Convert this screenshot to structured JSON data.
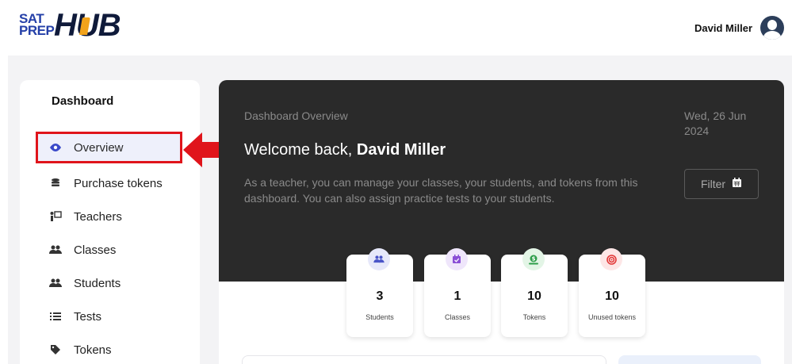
{
  "header": {
    "logo_top": "SAT",
    "logo_bottom": "PREP",
    "logo_hub": "HUB",
    "user_name": "David Miller"
  },
  "sidebar": {
    "title": "Dashboard",
    "items": [
      {
        "label": "Overview",
        "icon": "eye-icon",
        "active": true
      },
      {
        "label": "Purchase tokens",
        "icon": "coins-icon"
      },
      {
        "label": "Teachers",
        "icon": "teacher-icon"
      },
      {
        "label": "Classes",
        "icon": "users-icon"
      },
      {
        "label": "Students",
        "icon": "users-icon"
      },
      {
        "label": "Tests",
        "icon": "list-icon"
      },
      {
        "label": "Tokens",
        "icon": "tag-icon"
      }
    ]
  },
  "hero": {
    "subtitle": "Dashboard Overview",
    "date": "Wed, 26 Jun 2024",
    "welcome_prefix": "Welcome back, ",
    "welcome_name": "David Miller",
    "description": "As a teacher, you can manage your classes, your students, and tokens from this dashboard. You can also assign practice tests to your students.",
    "filter_label": "Filter"
  },
  "stats": [
    {
      "value": "3",
      "label": "Students",
      "icon": "users-icon",
      "color": "#4a55c8",
      "bg": "#e6e8fa"
    },
    {
      "value": "1",
      "label": "Classes",
      "icon": "calendar-check-icon",
      "color": "#8a4fd6",
      "bg": "#efe6fb"
    },
    {
      "value": "10",
      "label": "Tokens",
      "icon": "money-icon",
      "color": "#2e9e4a",
      "bg": "#e3f5e6"
    },
    {
      "value": "10",
      "label": "Unused tokens",
      "icon": "target-icon",
      "color": "#e23a3a",
      "bg": "#fde6e6"
    }
  ],
  "colors": {
    "accent": "#3a49c9",
    "highlight": "#e0141b",
    "hero_bg": "#2a2a2a"
  }
}
